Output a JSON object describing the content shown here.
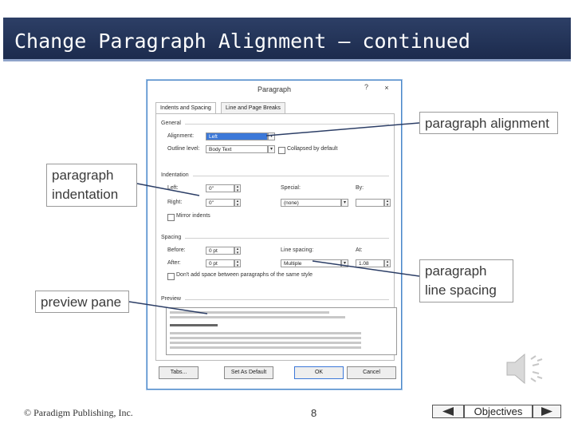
{
  "slide": {
    "title": "Change Paragraph Alignment – continued",
    "copyright": "© Paradigm Publishing, Inc.",
    "page_number": "8",
    "objectives_label": "Objectives",
    "prev_icon": "triangle-left-icon",
    "next_icon": "triangle-right-icon",
    "speaker_icon": "speaker-icon"
  },
  "callouts": {
    "alignment": "paragraph alignment",
    "indentation_line1": "paragraph",
    "indentation_line2": "indentation",
    "line_spacing_line1": "paragraph",
    "line_spacing_line2": "line spacing",
    "preview": "preview pane"
  },
  "dialog": {
    "title": "Paragraph",
    "help": "?",
    "close": "×",
    "tabs": [
      "Indents and Spacing",
      "Line and Page Breaks"
    ],
    "general": {
      "section": "General",
      "alignment_label": "Alignment:",
      "alignment_value": "Left",
      "outline_label": "Outline level:",
      "outline_value": "Body Text",
      "collapsed_label": "Collapsed by default"
    },
    "indentation": {
      "section": "Indentation",
      "left_label": "Left:",
      "left_value": "0\"",
      "right_label": "Right:",
      "right_value": "0\"",
      "special_label": "Special:",
      "special_value": "(none)",
      "by_label": "By:",
      "mirror_label": "Mirror indents"
    },
    "spacing": {
      "section": "Spacing",
      "before_label": "Before:",
      "before_value": "0 pt",
      "after_label": "After:",
      "after_value": "0 pt",
      "line_spacing_label": "Line spacing:",
      "line_spacing_value": "Multiple",
      "at_label": "At:",
      "at_value": "1.08",
      "dont_add_label": "Don't add space between paragraphs of the same style"
    },
    "preview": {
      "section": "Preview"
    },
    "buttons": {
      "tabs": "Tabs...",
      "set_default": "Set As Default",
      "ok": "OK",
      "cancel": "Cancel"
    }
  }
}
